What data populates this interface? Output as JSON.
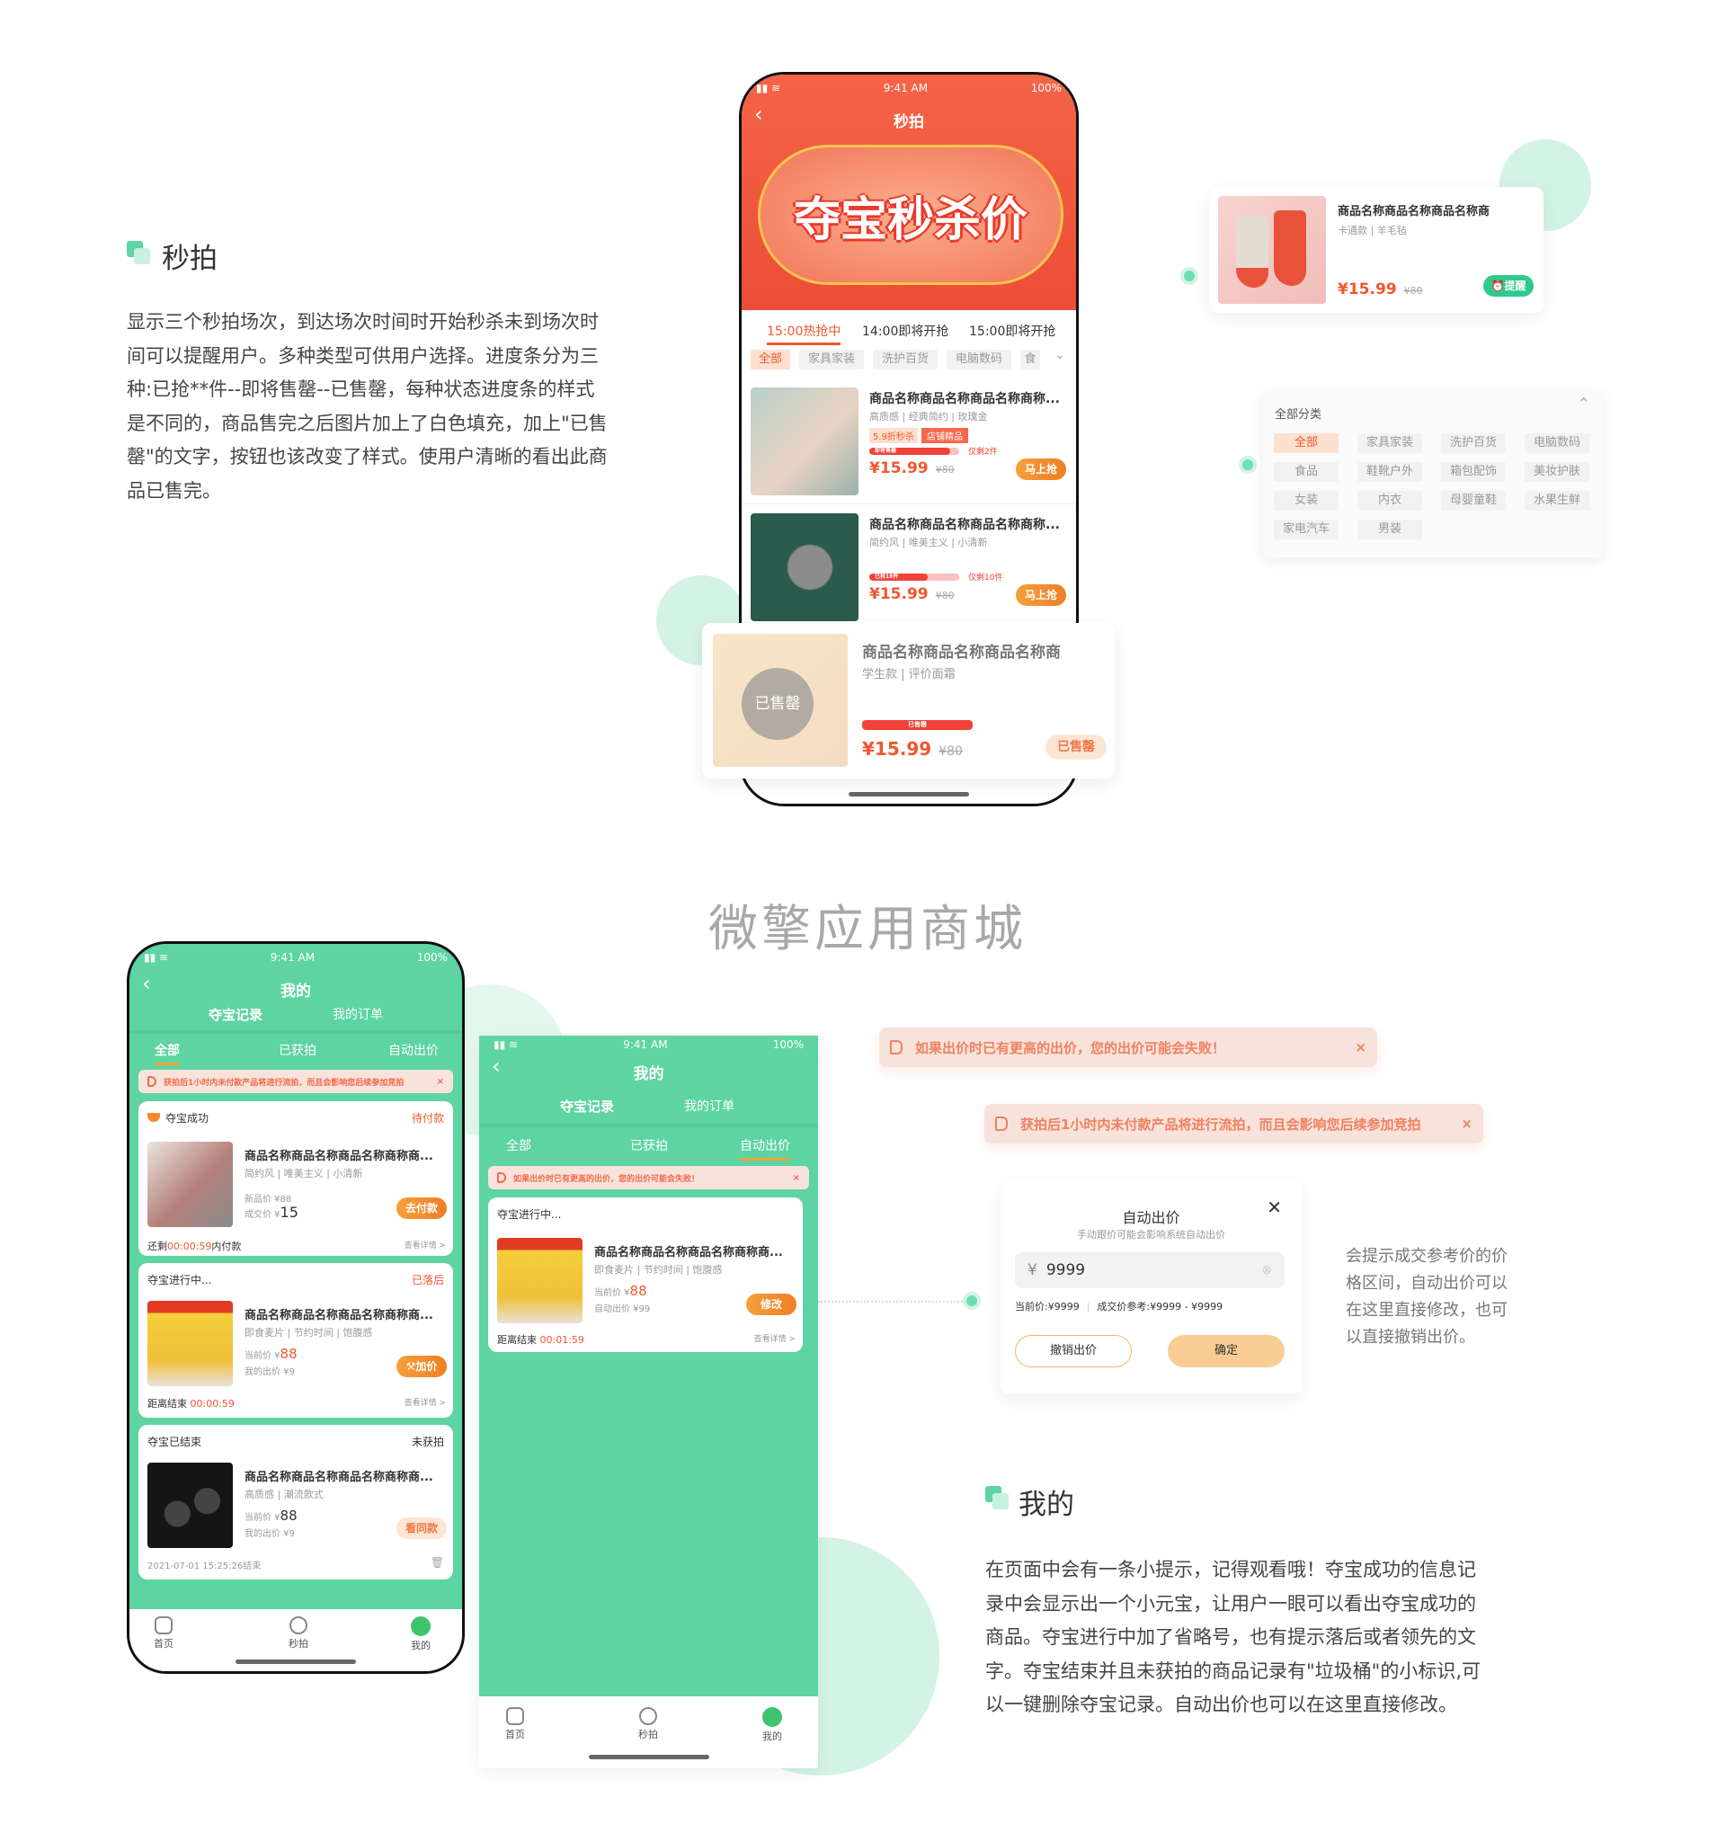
{
  "section1": {
    "title": "秒拍",
    "description": "显示三个秒拍场次，到达场次时间时开始秒杀未到场次时间可以提醒用户。多种类型可供用户选择。进度条分为三种:已抢**件--即将售罄--已售罄，每种状态进度条的样式是不同的，商品售完之后图片加上了白色填充，加上\"已售罄\"的文字，按钮也该改变了样式。使用户清晰的看出此商品已售完。"
  },
  "status_bar": {
    "time": "9:41 AM",
    "battery": "100%"
  },
  "flash_phone": {
    "nav_title": "秒拍",
    "banner_text": "夺宝秒杀价",
    "sessions": [
      {
        "label": "15:00热抢中",
        "active": true
      },
      {
        "label": "14:00即将开抢",
        "active": false
      },
      {
        "label": "15:00即将开抢",
        "active": false
      }
    ],
    "categories": [
      "全部",
      "家具家装",
      "洗护百货",
      "电脑数码",
      "食"
    ],
    "products": [
      {
        "name": "商品名称商品名称商品名称商称...",
        "tags": "高质感 | 经典简约 | 玫瑰金",
        "badges": [
          "5.9折秒杀",
          "店铺精品"
        ],
        "progress_label": "即将售罄",
        "progress": 0.9,
        "remaining": "仅剩2件",
        "price": "¥15.99",
        "original": "¥80",
        "button": "马上抢"
      },
      {
        "name": "商品名称商品名称商品名称商称...",
        "tags": "简约风 | 唯美主义 | 小清新",
        "progress_label": "已抢18件",
        "progress": 0.65,
        "remaining": "仅剩10件",
        "price": "¥15.99",
        "original": "¥80",
        "button": "马上抢"
      }
    ],
    "sold_out": {
      "name": "商品名称商品名称商品名称商",
      "tags": "学生款 | 评价面霜",
      "overlay": "已售罄",
      "progress_label": "已售罄",
      "progress": 1,
      "price": "¥15.99",
      "original": "¥80",
      "button": "已售罄"
    }
  },
  "remind_card": {
    "name": "商品名称商品名称商品名称商",
    "tags": "卡通款 | 羊毛毡",
    "price": "¥15.99",
    "original": "¥80",
    "button": "提醒"
  },
  "category_panel": {
    "title": "全部分类",
    "items": [
      "全部",
      "家具家装",
      "洗护百货",
      "电脑数码",
      "食品",
      "鞋靴户外",
      "箱包配饰",
      "美妆护肤",
      "女装",
      "内衣",
      "母婴童鞋",
      "水果生鲜",
      "家电汽车",
      "男装"
    ],
    "selected": "全部"
  },
  "watermark": "微擎应用商城",
  "mine_phone": {
    "nav_title": "我的",
    "top_tabs": [
      "夺宝记录",
      "我的订单"
    ],
    "sub_tabs": [
      "全部",
      "已获拍",
      "自动出价"
    ],
    "notice": "获拍后1小时内未付款产品将进行流拍，而且会影响您后续参加竞拍",
    "records": [
      {
        "status": "夺宝成功",
        "state": "待付款",
        "name": "商品名称商品名称商品名称商称商...",
        "tags": "简约风 | 唯美主义 | 小清新",
        "line1": "新品价 ¥88",
        "line2_label": "成交价 ¥",
        "line2_value": "15",
        "button": "去付款",
        "footer_pre": "还剩",
        "footer_time": "00:00:59",
        "footer_post": "内付款",
        "detail": "查看详情 >"
      },
      {
        "status": "夺宝进行中...",
        "state": "已落后",
        "name": "商品名称商品名称商品名称商称商...",
        "tags": "即食麦片 | 节约时间 | 饱腹感",
        "line1_label": "当前价 ¥",
        "line1_value": "88",
        "line2": "我的出价 ¥9",
        "button": "加价",
        "footer_pre": "距离结束 ",
        "footer_time": "00:00:59",
        "detail": "查看详情 >"
      },
      {
        "status": "夺宝已结束",
        "state": "未获拍",
        "name": "商品名称商品名称商品名称商称商...",
        "tags": "高质感 | 潮流款式",
        "line1_label": "当前价 ¥",
        "line1_value": "88",
        "line2": "我的出价 ¥9",
        "button": "看同款",
        "footer": "2021-07-01 15:25:26结束"
      }
    ],
    "tabbar": [
      "首页",
      "秒拍",
      "我的"
    ]
  },
  "auto_phone": {
    "nav_title": "我的",
    "top_tabs": [
      "夺宝记录",
      "我的订单"
    ],
    "sub_tabs": [
      "全部",
      "已获拍",
      "自动出价"
    ],
    "notice": "如果出价时已有更高的出价，您的出价可能会失败！",
    "record": {
      "status": "夺宝进行中...",
      "name": "商品名称商品名称商品名称商称商...",
      "tags": "即食麦片 | 节约时间 | 饱腹感",
      "line1_label": "当前价 ¥",
      "line1_value": "88",
      "line2": "自动出价 ¥99",
      "button": "修改",
      "footer_pre": "距离结束 ",
      "footer_time": "00:01:59",
      "detail": "查看详情 >"
    },
    "tabbar": [
      "首页",
      "秒拍",
      "我的"
    ]
  },
  "toasts": [
    "如果出价时已有更高的出价，您的出价可能会失败！",
    "获拍后1小时内未付款产品将进行流拍，而且会影响您后续参加竞拍"
  ],
  "dialog": {
    "title": "自动出价",
    "subtitle": "手动跟价可能会影响系统自动出价",
    "currency": "¥",
    "value": "9999",
    "current": "当前价:¥9999",
    "reference": "成交价参考:¥9999 - ¥9999",
    "cancel": "撤销出价",
    "confirm": "确定"
  },
  "dialog_note": "会提示成交参考价的价格区间，自动出价可以在这里直接修改，也可以直接撤销出价。",
  "section2": {
    "title": "我的",
    "description": "在页面中会有一条小提示，记得观看哦！夺宝成功的信息记录中会显示出一个小元宝，让用户一眼可以看出夺宝成功的商品。夺宝进行中加了省略号，也有提示落后或者领先的文字。夺宝结束并且未获拍的商品记录有\"垃圾桶\"的小标识,可以一键删除夺宝记录。自动出价也可以在这里直接修改。"
  },
  "colors": {
    "brand_green": "#5dd4a2",
    "flash_red": "#f05a3f",
    "accent_orange": "#ef7e25"
  }
}
